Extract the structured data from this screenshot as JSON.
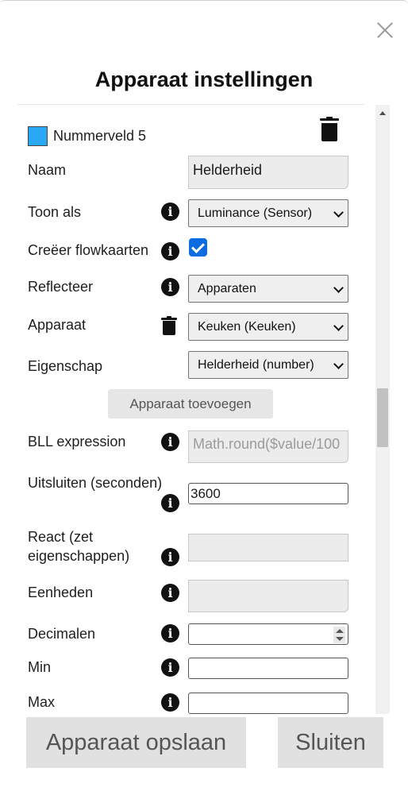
{
  "dialog": {
    "title": "Apparaat instellingen",
    "close_icon": "close-icon"
  },
  "device": {
    "color": "#2aa7f5",
    "name_header": "Nummerveld 5",
    "delete_icon": "trash-icon"
  },
  "fields": {
    "naam_label": "Naam",
    "naam_value": "Helderheid",
    "toon_als_label": "Toon als",
    "toon_als_value": "Luminance (Sensor)",
    "flowcards_label": "Creëer flowkaarten",
    "flowcards_checked": true,
    "reflecteer_label": "Reflecteer",
    "reflecteer_value": "Apparaten",
    "apparaat_label": "Apparaat",
    "apparaat_value": "Keuken (Keuken)",
    "eigenschap_label": "Eigenschap",
    "eigenschap_value": "Helderheid (number)",
    "add_device_button": "Apparaat toevoegen",
    "bll_label": "BLL expression",
    "bll_value": "Math.round($value/100",
    "uitsluiten_label": "Uitsluiten (seconden)",
    "uitsluiten_value": "3600",
    "react_label_line1": "React (zet",
    "react_label_line2": "eigenschappen)",
    "react_value": "",
    "eenheden_label": "Eenheden",
    "eenheden_value": "",
    "decimalen_label": "Decimalen",
    "decimalen_value": "",
    "min_label": "Min",
    "min_value": "",
    "max_label": "Max",
    "max_value": ""
  },
  "footer": {
    "save_label": "Apparaat opslaan",
    "close_label": "Sluiten"
  }
}
